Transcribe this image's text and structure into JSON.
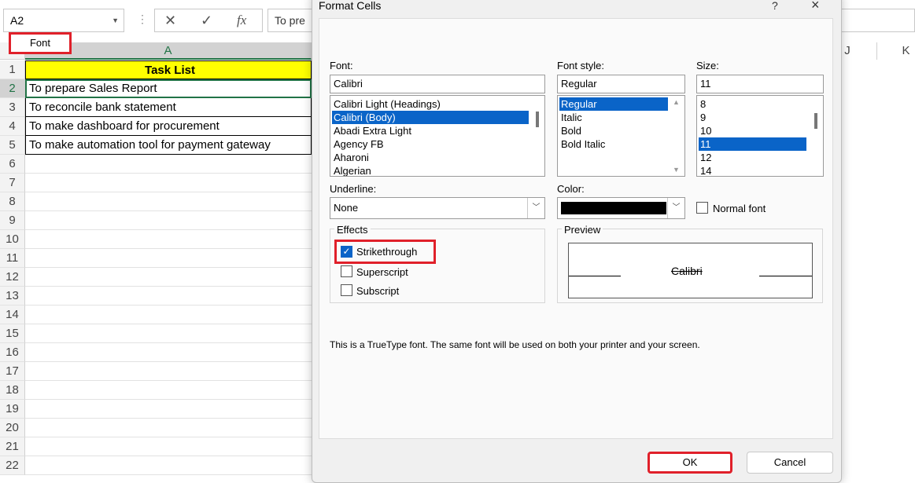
{
  "excel": {
    "name_box": "A2",
    "formula_text": "To pre",
    "column_headers": [
      "A",
      "J",
      "K"
    ],
    "row_numbers": [
      "1",
      "2",
      "3",
      "4",
      "5",
      "6",
      "7",
      "8",
      "9",
      "10",
      "11",
      "12",
      "13",
      "14",
      "15",
      "16",
      "17",
      "18",
      "19",
      "20",
      "21",
      "22"
    ],
    "title_cell": "Task List",
    "tasks": [
      "To prepare Sales Report",
      "To reconcile bank statement",
      "To make dashboard for procurement",
      "To make automation tool for payment gateway"
    ]
  },
  "dialog": {
    "title": "Format Cells",
    "help": "?",
    "close": "×",
    "tab": "Font",
    "font_label": "Font:",
    "font_value": "Calibri",
    "font_list": [
      "Calibri Light (Headings)",
      "Calibri (Body)",
      "Abadi Extra Light",
      "Agency FB",
      "Aharoni",
      "Algerian"
    ],
    "style_label": "Font style:",
    "style_value": "Regular",
    "style_list": [
      "Regular",
      "Italic",
      "Bold",
      "Bold Italic"
    ],
    "size_label": "Size:",
    "size_value": "11",
    "size_list": [
      "8",
      "9",
      "10",
      "11",
      "12",
      "14"
    ],
    "underline_label": "Underline:",
    "underline_value": "None",
    "color_label": "Color:",
    "color_value": "#000000",
    "normal_font": "Normal font",
    "effects_label": "Effects",
    "strikethrough": "Strikethrough",
    "superscript": "Superscript",
    "subscript": "Subscript",
    "preview_label": "Preview",
    "preview_text": "Calibri",
    "info": "This is a TrueType font.  The same font will be used on both your printer and your screen.",
    "ok": "OK",
    "cancel": "Cancel"
  }
}
